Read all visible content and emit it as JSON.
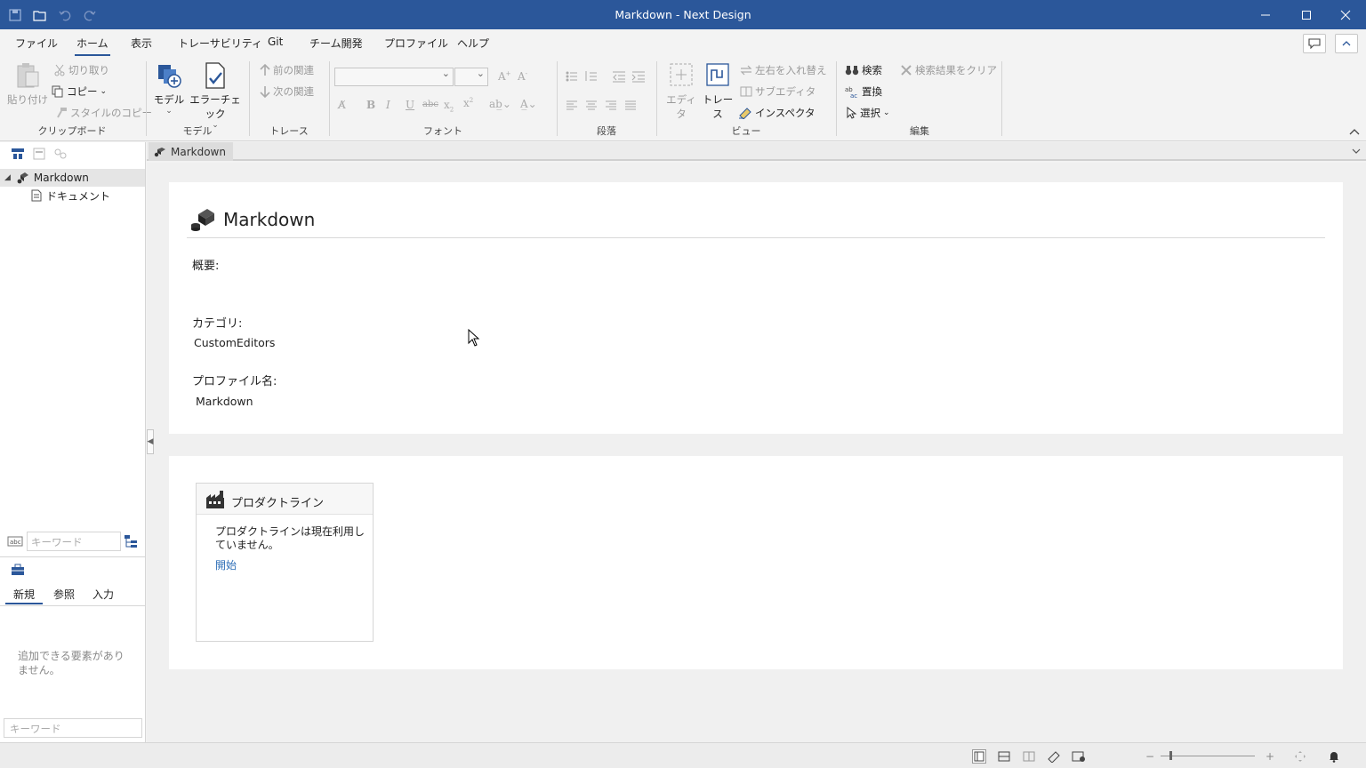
{
  "window": {
    "title": "Markdown - Next Design"
  },
  "menu": {
    "tabs": [
      "ファイル",
      "ホーム",
      "表示",
      "トレーサビリティ",
      "Git",
      "チーム開発",
      "プロファイル",
      "ヘルプ"
    ],
    "active": "ホーム"
  },
  "ribbon": {
    "clipboard": {
      "paste": "貼り付け",
      "cut": "切り取り",
      "copy": "コピー",
      "copy_style": "スタイルのコピー",
      "label": "クリップボード"
    },
    "model": {
      "model": "モデル",
      "error_check": "エラーチェック",
      "label": "モデル"
    },
    "trace": {
      "prev": "前の関連",
      "next": "次の関連",
      "label": "トレース"
    },
    "font": {
      "label": "フォント"
    },
    "paragraph": {
      "label": "段落"
    },
    "view": {
      "editor": "エディタ",
      "trace": "トレース",
      "swap": "左右を入れ替え",
      "sub_editor": "サブエディタ",
      "inspector": "インスペクタ",
      "label": "ビュー"
    },
    "edit": {
      "search": "検索",
      "replace": "置換",
      "select": "選択",
      "clear_results": "検索結果をクリア",
      "label": "編集"
    }
  },
  "tree": {
    "items": [
      {
        "label": "Markdown",
        "selected": true
      },
      {
        "label": "ドキュメント",
        "selected": false
      }
    ]
  },
  "left_search": {
    "placeholder": "キーワード"
  },
  "element_tabs": {
    "tabs": [
      "新規",
      "参照",
      "入力"
    ],
    "active": "新規"
  },
  "empty_message": "追加できる要素がありません。",
  "bottom_search": {
    "placeholder": "キーワード"
  },
  "doc_tab": {
    "label": "Markdown"
  },
  "project": {
    "title": "Markdown",
    "summary_label": "概要:",
    "summary_value": "",
    "category_label": "カテゴリ:",
    "category_value": "CustomEditors",
    "profile_label": "プロファイル名:",
    "profile_value": "Markdown"
  },
  "product_line": {
    "title": "プロダクトライン",
    "message": "プロダクトラインは現在利用していません。",
    "link": "開始"
  },
  "colors": {
    "titlebar": "#2b579a",
    "link": "#2f6fb7",
    "accent": "#2b579a"
  }
}
